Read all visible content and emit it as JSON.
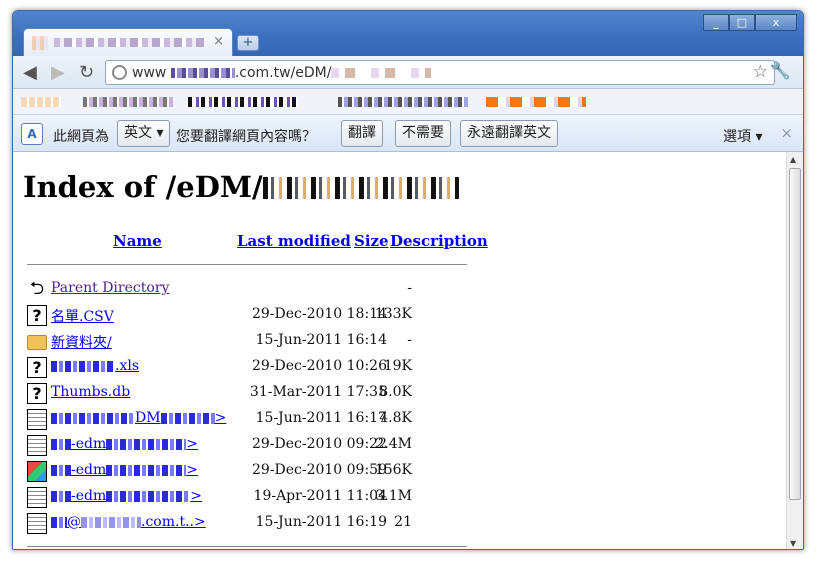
{
  "browser": {
    "tab_close": "×",
    "new_tab": "+",
    "window_controls": [
      "_",
      "□",
      "x"
    ],
    "url_prefix": "www",
    "url_mid": ".com.tw/eDM/",
    "nav_icons": [
      "back-arrow-icon",
      "forward-arrow-icon",
      "reload-icon"
    ]
  },
  "translate_bar": {
    "prompt": "此網頁為",
    "language": "英文",
    "question": "您要翻譯網頁內容嗎？",
    "translate_btn": "翻譯",
    "no_btn": "不需要",
    "always_btn": "永遠翻譯英文",
    "options": "選項",
    "close": "×"
  },
  "page": {
    "heading": "Index of /eDM/",
    "columns": {
      "name": "Name",
      "last_modified": "Last modified",
      "size": "Size",
      "description": "Description"
    },
    "rows": [
      {
        "icon": "back-icon",
        "name": "Parent Directory",
        "modified": "",
        "size": "-"
      },
      {
        "icon": "unknown-file-icon",
        "name": "名單.CSV",
        "modified": "29-Dec-2010 18:14",
        "size": "133K"
      },
      {
        "icon": "folder-icon",
        "name": "新資料夾/",
        "modified": "15-Jun-2011 16:14",
        "size": "-"
      },
      {
        "icon": "unknown-file-icon",
        "name": ".xls",
        "modified": "29-Dec-2010 10:26",
        "size": "19K"
      },
      {
        "icon": "unknown-file-icon",
        "name": "Thumbs.db",
        "modified": "31-Mar-2011 17:35",
        "size": "8.0K"
      },
      {
        "icon": "text-file-icon",
        "name": "DM",
        "name_suffix": ">",
        "modified": "15-Jun-2011 16:17",
        "size": "4.8K"
      },
      {
        "icon": "pdf-file-icon",
        "name": "-edm",
        "name_suffix": ">",
        "modified": "29-Dec-2010 09:22",
        "size": "2.4M"
      },
      {
        "icon": "image-file-icon",
        "name": "-edm",
        "name_suffix": ">",
        "modified": "29-Dec-2010 09:59",
        "size": "156K"
      },
      {
        "icon": "text-file-icon",
        "name": "-edm",
        "name_suffix": ">",
        "modified": "19-Apr-2011 11:04",
        "size": "3.1M"
      },
      {
        "icon": "text-file-icon",
        "name": "@",
        "name_suffix": ".com.t..>",
        "modified": "15-Jun-2011 16:19",
        "size": "21"
      }
    ]
  }
}
